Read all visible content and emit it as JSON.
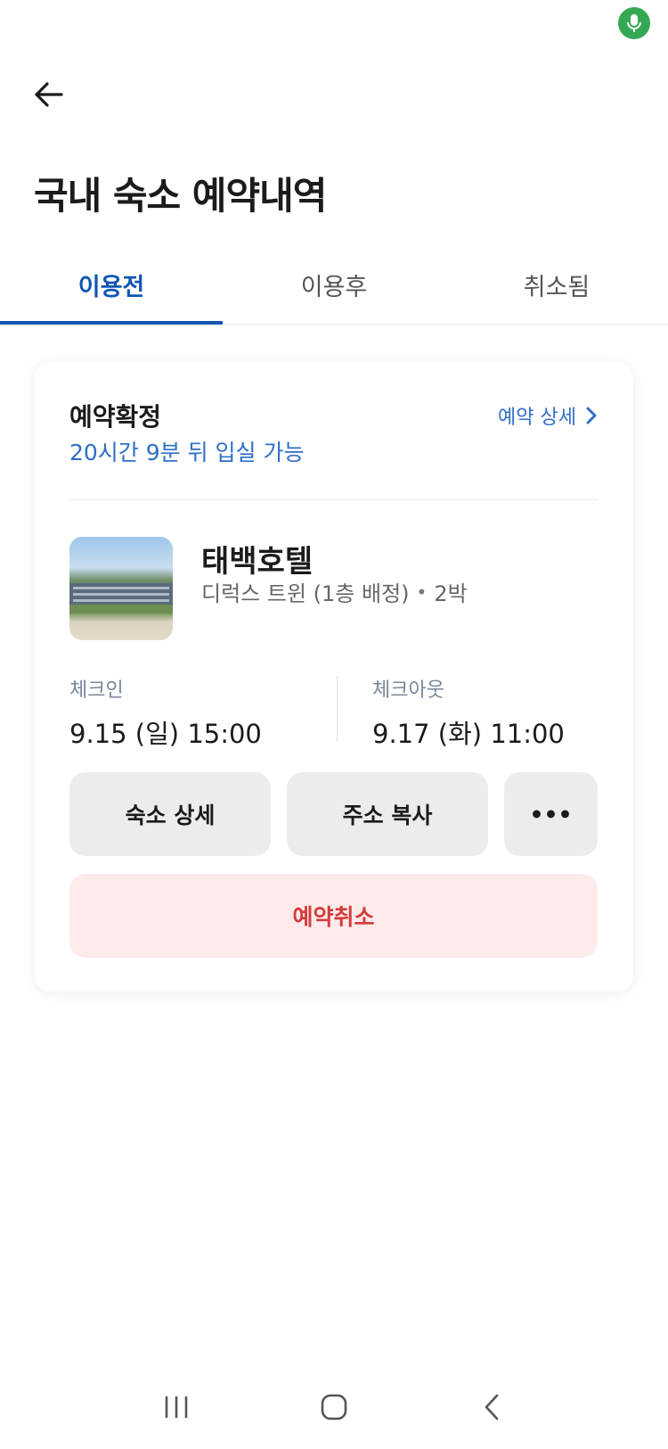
{
  "header": {
    "title": "국내 숙소 예약내역",
    "back_icon": "arrow-left-icon"
  },
  "tabs": [
    {
      "label": "이용전",
      "active": true
    },
    {
      "label": "이용후",
      "active": false
    },
    {
      "label": "취소됨",
      "active": false
    }
  ],
  "booking": {
    "status_title": "예약확정",
    "status_sub": "20시간 9분 뒤 입실 가능",
    "detail_link": "예약 상세",
    "hotel_name": "태백호텔",
    "room": "디럭스 트윈 (1층 배정)",
    "nights": "2박",
    "checkin_label": "체크인",
    "checkin_value": "9.15 (일) 15:00",
    "checkout_label": "체크아웃",
    "checkout_value": "9.17 (화) 11:00",
    "buttons": {
      "hotel_detail": "숙소 상세",
      "copy_address": "주소 복사",
      "more": "•••",
      "cancel": "예약취소"
    }
  },
  "colors": {
    "accent": "#0f56b3",
    "link": "#2f6fc7",
    "cancel_text": "#d33b3b",
    "cancel_bg": "#fdeaea"
  }
}
